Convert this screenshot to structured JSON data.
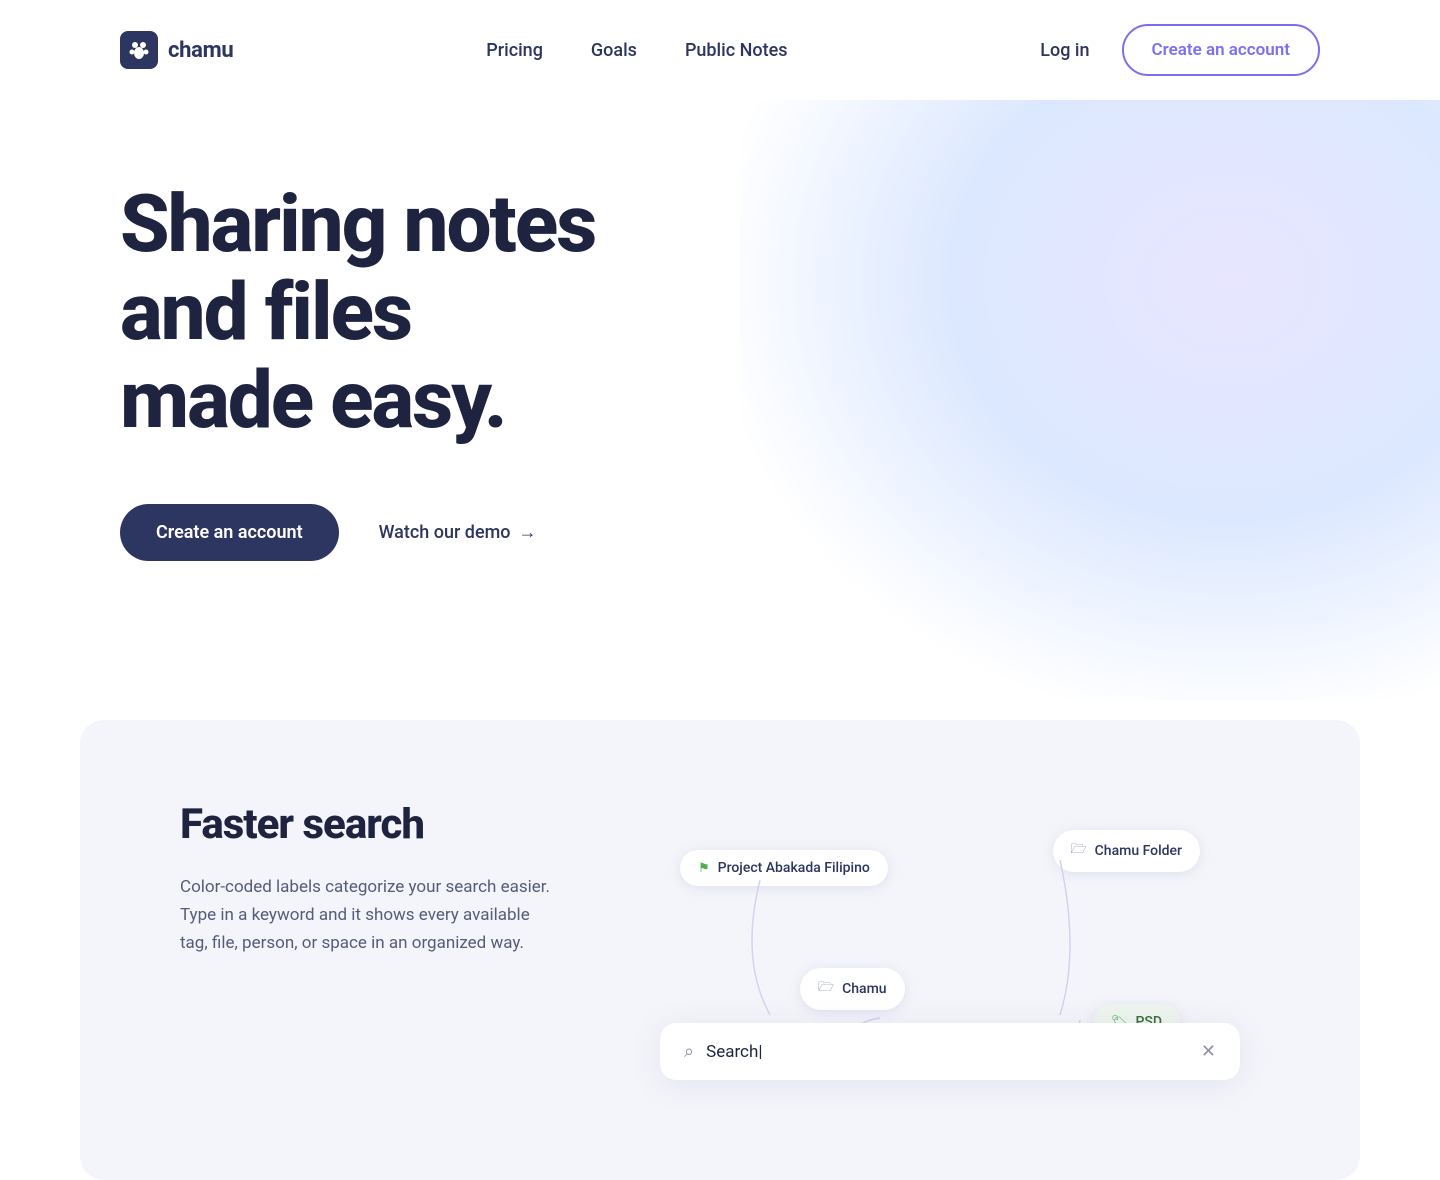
{
  "meta": {
    "title": "Chamu - Sharing notes and files made easy"
  },
  "header": {
    "logo_text": "chamu",
    "nav": {
      "items": [
        {
          "id": "pricing",
          "label": "Pricing"
        },
        {
          "id": "goals",
          "label": "Goals"
        },
        {
          "id": "public-notes",
          "label": "Public Notes"
        }
      ]
    },
    "login_label": "Log in",
    "cta_label": "Create an account"
  },
  "hero": {
    "title_line1": "Sharing notes",
    "title_line2": "and files",
    "title_line3": "made easy.",
    "cta_primary": "Create an account",
    "cta_secondary": "Watch our demo",
    "cta_secondary_arrow": "→"
  },
  "feature": {
    "title": "Faster search",
    "description": "Color-coded labels categorize your search easier. Type in a keyword and it shows every available tag, file, person, or space in an organized way.",
    "search": {
      "placeholder": "Search|",
      "tag1": "Project Abakada Filipino",
      "tag2": "Chamu Folder",
      "tag3": "Chamu",
      "tag4": "PSD"
    }
  },
  "icons": {
    "search": "🔍",
    "close": "✕",
    "folder": "🗂",
    "tag": "🏷",
    "arrow_right": "→",
    "paw": "🐾"
  }
}
